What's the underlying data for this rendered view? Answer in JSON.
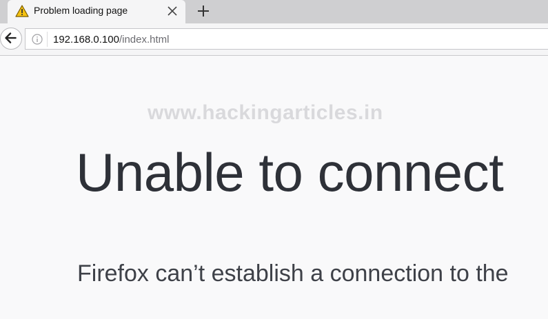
{
  "tab": {
    "title": "Problem loading page",
    "warning_icon": "warning-triangle-icon",
    "close_icon": "close-icon"
  },
  "new_tab_icon": "plus-icon",
  "navbar": {
    "back_icon": "back-arrow-icon",
    "info_icon": "info-icon",
    "url_host": "192.168.0.100",
    "url_path": "/index.html"
  },
  "page": {
    "watermark": "www.hackingarticles.in",
    "title": "Unable to connect",
    "description": "Firefox can’t establish a connection to the"
  },
  "colors": {
    "tabstrip": "#cfcfd1",
    "page_background": "#f9f9fa",
    "title_text": "#2e3138",
    "warning_yellow": "#f5c211"
  }
}
